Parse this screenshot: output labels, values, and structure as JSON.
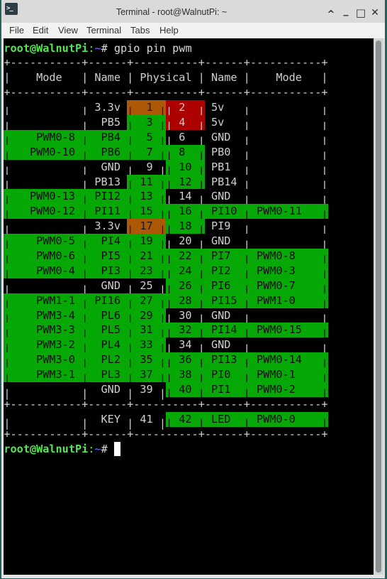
{
  "window": {
    "title": "Terminal - root@WalnutPi: ~",
    "icon": {
      "name": "terminal-icon",
      "glyph": ">_"
    },
    "controls": [
      {
        "name": "shade-up-icon",
        "glyph": "^"
      },
      {
        "name": "minimize-icon",
        "glyph": "_"
      },
      {
        "name": "maximize-icon",
        "glyph": "□"
      },
      {
        "name": "close-icon",
        "glyph": "✕"
      }
    ]
  },
  "menu": {
    "items": [
      "File",
      "Edit",
      "View",
      "Terminal",
      "Tabs",
      "Help"
    ]
  },
  "palette": {
    "none": {
      "bg": "#000000",
      "fg": "#d0d0d0"
    },
    "green": {
      "bg": "#06a806",
      "fg": "#0c0c0c"
    },
    "orange": {
      "bg": "#ac5806",
      "fg": "#1a1a1a"
    },
    "red": {
      "bg": "#ad0000",
      "fg": "#dcc4c4"
    }
  },
  "terminal": {
    "command_prompt": {
      "user_host": "root@WalnutPi",
      "sep": ":",
      "path": "~",
      "symbol": "#",
      "command": "gpio pin pwm"
    },
    "final_prompt": {
      "user_host": "root@WalnutPi",
      "sep": ":",
      "path": "~",
      "symbol": "#"
    },
    "table": {
      "separator": "+-----------+------+----------+------+-----------+",
      "pipe": "|",
      "header": [
        "Mode",
        "Name",
        "Physical",
        "Name",
        "Mode"
      ],
      "rows": [
        {
          "left_mode": "",
          "left_name": "3.3v",
          "left_pin": "1",
          "right_pin": "2",
          "right_name": "5v",
          "right_mode": "",
          "colors": {
            "left": "none",
            "left_pin": "orange",
            "right_pin": "red",
            "right": "none"
          }
        },
        {
          "left_mode": "",
          "left_name": "PB5",
          "left_pin": "3",
          "right_pin": "4",
          "right_name": "5v",
          "right_mode": "",
          "colors": {
            "left": "none",
            "left_pin": "green",
            "right_pin": "red",
            "right": "none"
          }
        },
        {
          "left_mode": "PWM0-8",
          "left_name": "PB4",
          "left_pin": "5",
          "right_pin": "6",
          "right_name": "GND",
          "right_mode": "",
          "colors": {
            "left": "green",
            "left_pin": "green",
            "right_pin": "none",
            "right": "none"
          }
        },
        {
          "left_mode": "PWM0-10",
          "left_name": "PB6",
          "left_pin": "7",
          "right_pin": "8",
          "right_name": "PB0",
          "right_mode": "",
          "colors": {
            "left": "green",
            "left_pin": "green",
            "right_pin": "green",
            "right": "none"
          }
        },
        {
          "left_mode": "",
          "left_name": "GND",
          "left_pin": "9",
          "right_pin": "10",
          "right_name": "PB1",
          "right_mode": "",
          "colors": {
            "left": "none",
            "left_pin": "none",
            "right_pin": "green",
            "right": "none"
          }
        },
        {
          "left_mode": "",
          "left_name": "PB13",
          "left_pin": "11",
          "right_pin": "12",
          "right_name": "PB14",
          "right_mode": "",
          "colors": {
            "left": "none",
            "left_pin": "green",
            "right_pin": "green",
            "right": "none"
          }
        },
        {
          "left_mode": "PWM0-13",
          "left_name": "PI12",
          "left_pin": "13",
          "right_pin": "14",
          "right_name": "GND",
          "right_mode": "",
          "colors": {
            "left": "green",
            "left_pin": "green",
            "right_pin": "none",
            "right": "none"
          }
        },
        {
          "left_mode": "PWM0-12",
          "left_name": "PI11",
          "left_pin": "15",
          "right_pin": "16",
          "right_name": "PI10",
          "right_mode": "PWM0-11",
          "colors": {
            "left": "green",
            "left_pin": "green",
            "right_pin": "green",
            "right": "green"
          }
        },
        {
          "left_mode": "",
          "left_name": "3.3v",
          "left_pin": "17",
          "right_pin": "18",
          "right_name": "PI9",
          "right_mode": "",
          "colors": {
            "left": "none",
            "left_pin": "orange",
            "right_pin": "green",
            "right": "none"
          }
        },
        {
          "left_mode": "PWM0-5",
          "left_name": "PI4",
          "left_pin": "19",
          "right_pin": "20",
          "right_name": "GND",
          "right_mode": "",
          "colors": {
            "left": "green",
            "left_pin": "green",
            "right_pin": "none",
            "right": "none"
          }
        },
        {
          "left_mode": "PWM0-6",
          "left_name": "PI5",
          "left_pin": "21",
          "right_pin": "22",
          "right_name": "PI7",
          "right_mode": "PWM0-8",
          "colors": {
            "left": "green",
            "left_pin": "green",
            "right_pin": "green",
            "right": "green"
          }
        },
        {
          "left_mode": "PWM0-4",
          "left_name": "PI3",
          "left_pin": "23",
          "right_pin": "24",
          "right_name": "PI2",
          "right_mode": "PWM0-3",
          "colors": {
            "left": "green",
            "left_pin": "green",
            "right_pin": "green",
            "right": "green"
          }
        },
        {
          "left_mode": "",
          "left_name": "GND",
          "left_pin": "25",
          "right_pin": "26",
          "right_name": "PI6",
          "right_mode": "PWM0-7",
          "colors": {
            "left": "none",
            "left_pin": "none",
            "right_pin": "green",
            "right": "green"
          }
        },
        {
          "left_mode": "PWM1-1",
          "left_name": "PI16",
          "left_pin": "27",
          "right_pin": "28",
          "right_name": "PI15",
          "right_mode": "PWM1-0",
          "colors": {
            "left": "green",
            "left_pin": "green",
            "right_pin": "green",
            "right": "green"
          }
        },
        {
          "left_mode": "PWM3-4",
          "left_name": "PL6",
          "left_pin": "29",
          "right_pin": "30",
          "right_name": "GND",
          "right_mode": "",
          "colors": {
            "left": "green",
            "left_pin": "green",
            "right_pin": "none",
            "right": "none"
          }
        },
        {
          "left_mode": "PWM3-3",
          "left_name": "PL5",
          "left_pin": "31",
          "right_pin": "32",
          "right_name": "PI14",
          "right_mode": "PWM0-15",
          "colors": {
            "left": "green",
            "left_pin": "green",
            "right_pin": "green",
            "right": "green"
          }
        },
        {
          "left_mode": "PWM3-2",
          "left_name": "PL4",
          "left_pin": "33",
          "right_pin": "34",
          "right_name": "GND",
          "right_mode": "",
          "colors": {
            "left": "green",
            "left_pin": "green",
            "right_pin": "none",
            "right": "none"
          }
        },
        {
          "left_mode": "PWM3-0",
          "left_name": "PL2",
          "left_pin": "35",
          "right_pin": "36",
          "right_name": "PI13",
          "right_mode": "PWM0-14",
          "colors": {
            "left": "green",
            "left_pin": "green",
            "right_pin": "green",
            "right": "green"
          }
        },
        {
          "left_mode": "PWM3-1",
          "left_name": "PL3",
          "left_pin": "37",
          "right_pin": "38",
          "right_name": "PI0",
          "right_mode": "PWM0-1",
          "colors": {
            "left": "green",
            "left_pin": "green",
            "right_pin": "green",
            "right": "green"
          }
        },
        {
          "left_mode": "",
          "left_name": "GND",
          "left_pin": "39",
          "right_pin": "40",
          "right_name": "PI1",
          "right_mode": "PWM0-2",
          "colors": {
            "left": "none",
            "left_pin": "none",
            "right_pin": "green",
            "right": "green"
          }
        }
      ],
      "extra_rows": [
        {
          "left_mode": "",
          "left_name": "KEY",
          "left_pin": "41",
          "right_pin": "42",
          "right_name": "LED",
          "right_mode": "PWM0-0",
          "colors": {
            "left": "none",
            "left_pin": "none",
            "right_pin": "green",
            "right": "green"
          }
        }
      ]
    }
  }
}
